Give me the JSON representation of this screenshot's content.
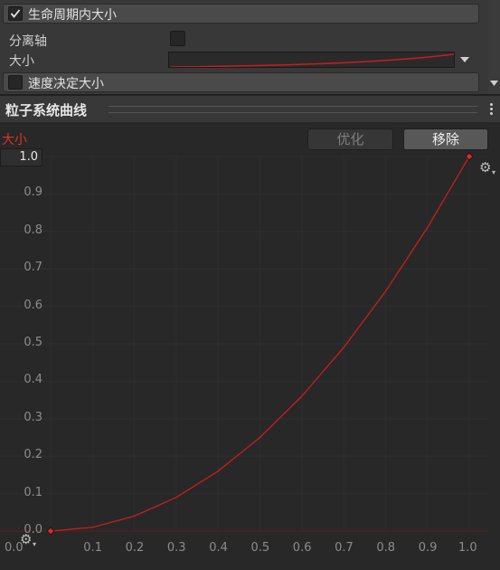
{
  "inspector": {
    "size_over_lifetime": {
      "label": "生命周期内大小",
      "checked": true
    },
    "separate_axes_label": "分离轴",
    "size_label": "大小",
    "size_by_speed": {
      "label": "速度决定大小",
      "checked": false
    }
  },
  "curves_panel": {
    "title": "粒子系统曲线",
    "curve_name": "大小",
    "optimize_label": "优化",
    "remove_label": "移除",
    "y_max_value": "1.0"
  },
  "colors": {
    "curve": "#c81e1e",
    "key": "#e52525",
    "curve_label": "#e0312b"
  },
  "chart_data": {
    "type": "line",
    "title": "",
    "xlabel": "",
    "ylabel": "",
    "x_ticks": [
      "0.0",
      "0.1",
      "0.2",
      "0.3",
      "0.4",
      "0.5",
      "0.6",
      "0.7",
      "0.8",
      "0.9",
      "1.0"
    ],
    "y_ticks": [
      "0.0",
      "0.1",
      "0.2",
      "0.3",
      "0.4",
      "0.5",
      "0.6",
      "0.7",
      "0.8",
      "0.9"
    ],
    "xlim": [
      0,
      1.09
    ],
    "ylim": [
      0,
      1.0
    ],
    "series": [
      {
        "name": "大小",
        "x": [
          0.0,
          0.1,
          0.2,
          0.3,
          0.4,
          0.5,
          0.6,
          0.7,
          0.8,
          0.9,
          1.0
        ],
        "y": [
          0.0,
          0.01,
          0.04,
          0.09,
          0.16,
          0.25,
          0.36,
          0.49,
          0.64,
          0.81,
          1.0
        ]
      }
    ],
    "keys": [
      {
        "x": 0.0,
        "y": 0.0
      },
      {
        "x": 1.0,
        "y": 1.0
      }
    ]
  }
}
